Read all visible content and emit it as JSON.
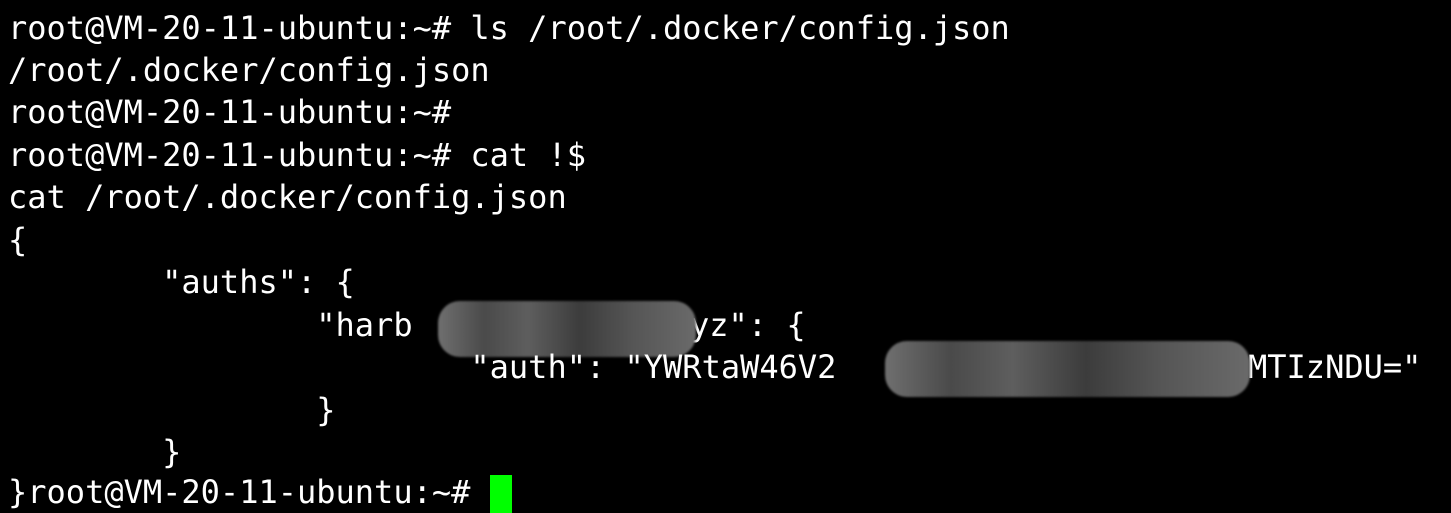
{
  "terminal": {
    "lines": [
      "root@VM-20-11-ubuntu:~# ls /root/.docker/config.json",
      "/root/.docker/config.json",
      "root@VM-20-11-ubuntu:~#",
      "root@VM-20-11-ubuntu:~# cat !$",
      "cat /root/.docker/config.json",
      "{",
      "        \"auths\": {",
      "                \"harb",
      "yz\": {",
      "                        \"auth\": \"YWRtaW46V2",
      "MTIzNDU=\"",
      "                }",
      "        }",
      "}root@VM-20-11-ubuntu:~# "
    ]
  },
  "colors": {
    "background": "#000000",
    "text": "#ffffff",
    "cursor": "#00ff00",
    "redaction": "#555555"
  }
}
